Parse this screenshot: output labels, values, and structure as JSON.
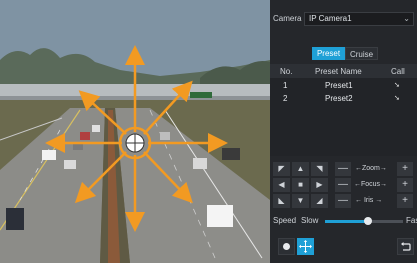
{
  "camera": {
    "label": "Camera",
    "selected": "IP Camera1"
  },
  "tabs": {
    "preset": "Preset",
    "cruise": "Cruise"
  },
  "table": {
    "headers": {
      "no": "No.",
      "name": "Preset Name",
      "call": "Call"
    },
    "rows": [
      {
        "no": "1",
        "name": "Preset1"
      },
      {
        "no": "2",
        "name": "Preset2"
      }
    ]
  },
  "ptz": {
    "zoom_label": "←Zoom→",
    "focus_label": "←Focus→",
    "iris_label": "←  Iris  →",
    "minus": "—",
    "plus": "+"
  },
  "speed": {
    "label": "Speed",
    "slow": "Slow",
    "fast": "Fas",
    "value_fraction": 0.55
  },
  "colors": {
    "accent": "#1fa0d6",
    "arrow": "#f29a22",
    "panel": "#25272b"
  },
  "icons": {
    "call_icon": "cursor-icon",
    "record": "record-icon",
    "move": "move-arrows-icon",
    "exit": "exit-icon"
  }
}
